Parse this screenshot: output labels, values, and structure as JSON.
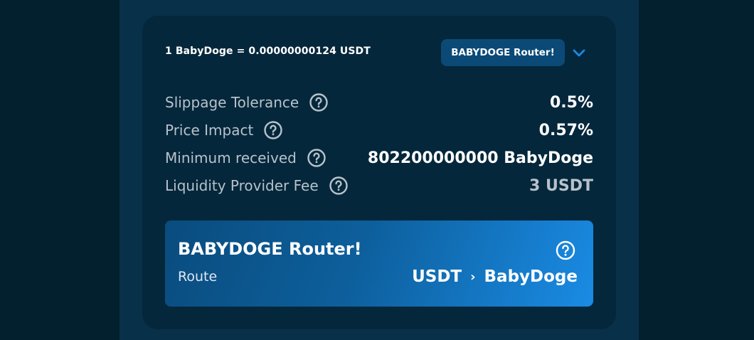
{
  "rate": {
    "text": "1 BabyDoge = 0.00000000124 USDT"
  },
  "router_badge": {
    "label": "BABYDOGE Router!"
  },
  "details": {
    "slippage": {
      "label": "Slippage Tolerance",
      "value": "0.5%"
    },
    "price_impact": {
      "label": "Price Impact",
      "value": "0.57%"
    },
    "minimum_received": {
      "label": "Minimum received",
      "value": "802200000000 BabyDoge"
    },
    "lp_fee": {
      "label": "Liquidity Provider Fee",
      "value": "3 USDT"
    }
  },
  "route_card": {
    "title": "BABYDOGE Router!",
    "route_label": "Route",
    "path": {
      "from": "USDT",
      "separator": "›",
      "to": "BabyDoge"
    }
  },
  "icons": {
    "help": "question-circle-icon",
    "dropdown": "chevron-down-icon"
  },
  "colors": {
    "accent": "#1a8be4",
    "card": "#05273b",
    "label_text": "#b7c2cb"
  }
}
